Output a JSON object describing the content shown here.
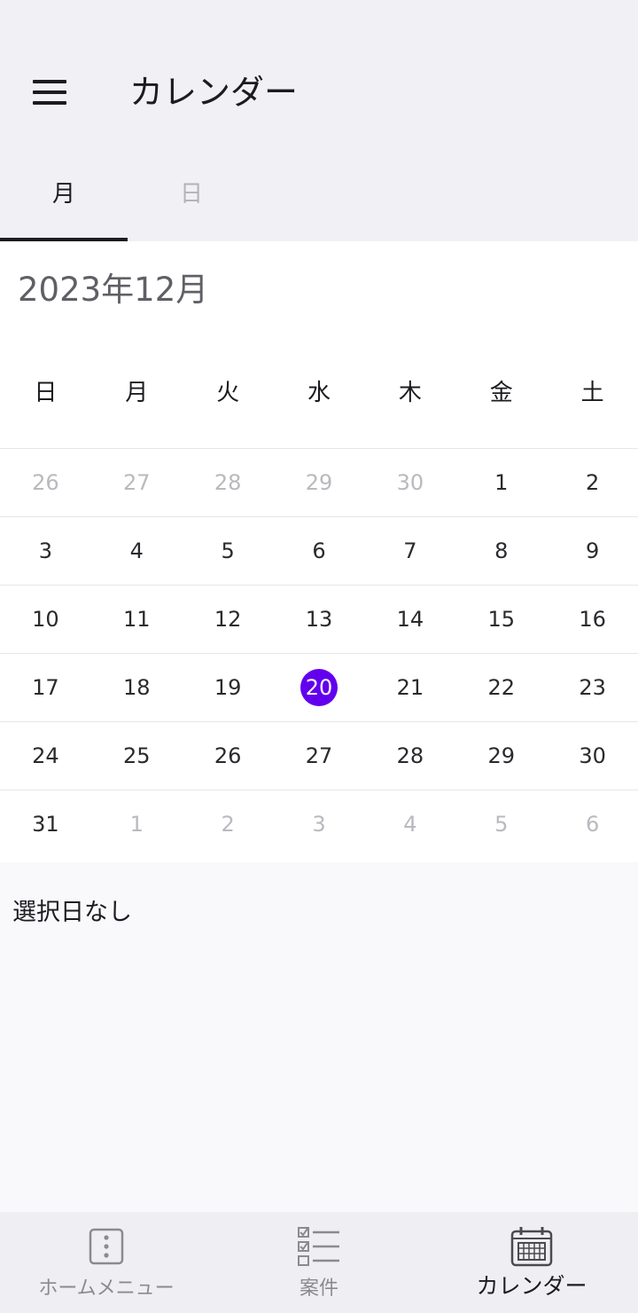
{
  "header": {
    "title": "カレンダー"
  },
  "tabs": [
    {
      "label": "月",
      "selected": true
    },
    {
      "label": "日",
      "selected": false
    }
  ],
  "calendar": {
    "month_label": "2023年12月",
    "weekdays": [
      "日",
      "月",
      "火",
      "水",
      "木",
      "金",
      "土"
    ],
    "weeks": [
      [
        "26",
        "27",
        "28",
        "29",
        "30",
        "1",
        "2"
      ],
      [
        "3",
        "4",
        "5",
        "6",
        "7",
        "8",
        "9"
      ],
      [
        "10",
        "11",
        "12",
        "13",
        "14",
        "15",
        "16"
      ],
      [
        "17",
        "18",
        "19",
        "20",
        "21",
        "22",
        "23"
      ],
      [
        "24",
        "25",
        "26",
        "27",
        "28",
        "29",
        "30"
      ],
      [
        "31",
        "1",
        "2",
        "3",
        "4",
        "5",
        "6"
      ]
    ],
    "outside_month": [
      [
        true,
        true,
        true,
        true,
        true,
        false,
        false
      ],
      [
        false,
        false,
        false,
        false,
        false,
        false,
        false
      ],
      [
        false,
        false,
        false,
        false,
        false,
        false,
        false
      ],
      [
        false,
        false,
        false,
        false,
        false,
        false,
        false
      ],
      [
        false,
        false,
        false,
        false,
        false,
        false,
        false
      ],
      [
        false,
        true,
        true,
        true,
        true,
        true,
        true
      ]
    ],
    "today": "20",
    "accent_color": "#6200ee"
  },
  "selection": {
    "empty_text": "選択日なし"
  },
  "bottom_nav": [
    {
      "label": "ホームメニュー",
      "icon": "more-vertical-icon",
      "active": false
    },
    {
      "label": "案件",
      "icon": "checklist-icon",
      "active": false
    },
    {
      "label": "カレンダー",
      "icon": "calendar-icon",
      "active": true
    }
  ]
}
